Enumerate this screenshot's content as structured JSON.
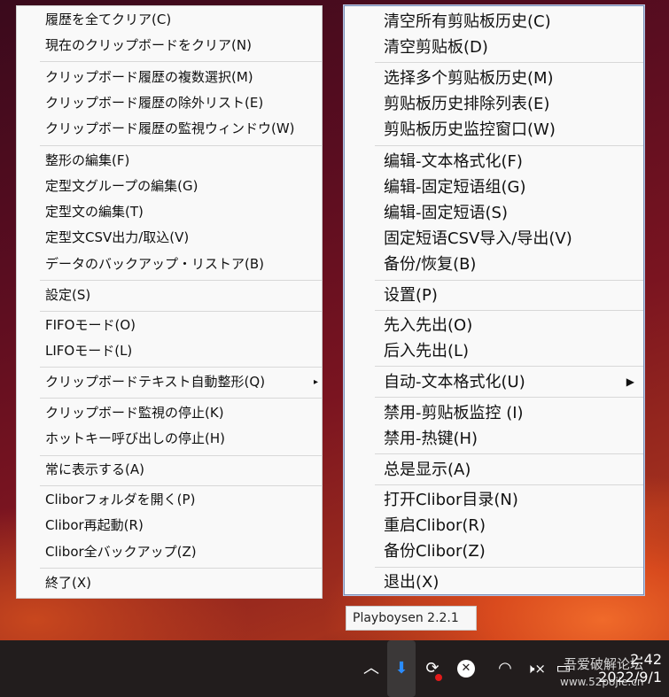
{
  "menu_jp": {
    "items": [
      {
        "label": "履歴を全てクリア(C)"
      },
      {
        "label": "現在のクリップボードをクリア(N)"
      },
      {
        "label": "クリップボード履歴の複数選択(M)"
      },
      {
        "label": "クリップボード履歴の除外リスト(E)"
      },
      {
        "label": "クリップボード履歴の監視ウィンドウ(W)"
      },
      {
        "label": "整形の編集(F)"
      },
      {
        "label": "定型文グループの編集(G)"
      },
      {
        "label": "定型文の編集(T)"
      },
      {
        "label": "定型文CSV出力/取込(V)"
      },
      {
        "label": "データのバックアップ・リストア(B)"
      },
      {
        "label": "設定(S)"
      },
      {
        "label": "FIFOモード(O)"
      },
      {
        "label": "LIFOモード(L)"
      },
      {
        "label": "クリップボードテキスト自動整形(Q)"
      },
      {
        "label": "クリップボード監視の停止(K)"
      },
      {
        "label": "ホットキー呼び出しの停止(H)"
      },
      {
        "label": "常に表示する(A)"
      },
      {
        "label": "Cliborフォルダを開く(P)"
      },
      {
        "label": "Clibor再起動(R)"
      },
      {
        "label": "Clibor全バックアップ(Z)"
      },
      {
        "label": "終了(X)"
      }
    ],
    "submenu_arrow": "▸"
  },
  "menu_cn": {
    "items": [
      {
        "label": "清空所有剪贴板历史(C)"
      },
      {
        "label": "清空剪贴板(D)"
      },
      {
        "label": "选择多个剪贴板历史(M)"
      },
      {
        "label": "剪贴板历史排除列表(E)"
      },
      {
        "label": "剪贴板历史监控窗口(W)"
      },
      {
        "label": "编辑-文本格式化(F)"
      },
      {
        "label": "编辑-固定短语组(G)"
      },
      {
        "label": "编辑-固定短语(S)"
      },
      {
        "label": "固定短语CSV导入/导出(V)"
      },
      {
        "label": "备份/恢复(B)"
      },
      {
        "label": "设置(P)"
      },
      {
        "label": "先入先出(O)"
      },
      {
        "label": "后入先出(L)"
      },
      {
        "label": "自动-文本格式化(U)"
      },
      {
        "label": "禁用-剪贴板监控 (I)"
      },
      {
        "label": "禁用-热键(H)"
      },
      {
        "label": "总是显示(A)"
      },
      {
        "label": "打开Clibor目录(N)"
      },
      {
        "label": "重启Clibor(R)"
      },
      {
        "label": "备份Clibor(Z)"
      },
      {
        "label": "退出(X)"
      }
    ],
    "submenu_arrow": "▶"
  },
  "tooltip": {
    "text": "Playboysen 2.2.1"
  },
  "taskbar": {
    "icons": [
      "chevron-up-icon",
      "clibor-tray-icon",
      "sync-icon",
      "close-circle-icon",
      "wifi-icon",
      "speaker-muted-icon",
      "battery-icon"
    ],
    "glyphs": {
      "chevron": "︿",
      "clibor": "⬇",
      "sync": "⟳",
      "close": "✕",
      "wifi": "◠",
      "speaker": "🕨×",
      "battery": "▭"
    },
    "time": "2:42",
    "date": "2022/9/1",
    "watermark_title": "吾爱破解论坛",
    "watermark_url": "www.52pojie.cn"
  }
}
